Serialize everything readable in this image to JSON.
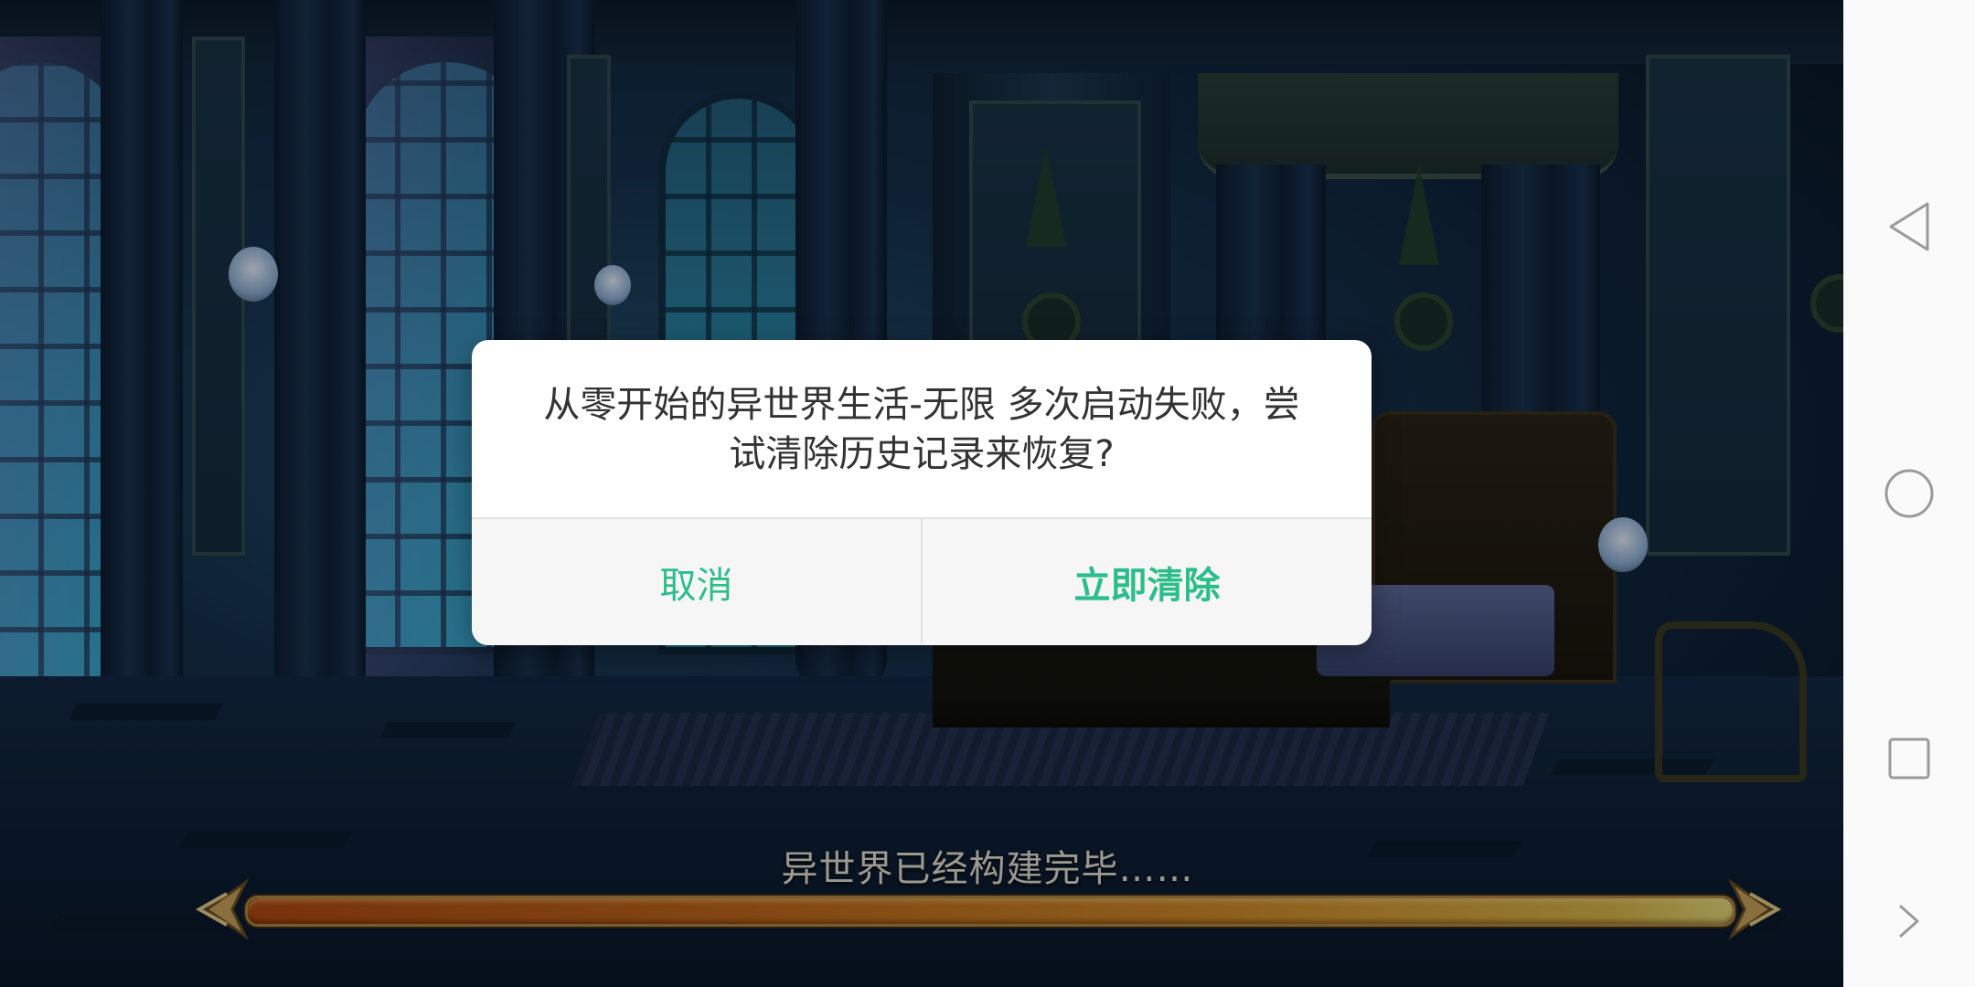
{
  "game": {
    "loading_text": "异世界已经构建完毕……",
    "progress": 1.0
  },
  "dialog": {
    "message": "从零开始的异世界生活-无限 多次启动失败，尝试清除历史记录来恢复?",
    "cancel_label": "取消",
    "confirm_label": "立即清除",
    "accent_color": "#2bbd8a"
  },
  "nav_bar": {
    "buttons": [
      "back-icon",
      "home-icon",
      "recents-icon",
      "expand-icon"
    ]
  }
}
